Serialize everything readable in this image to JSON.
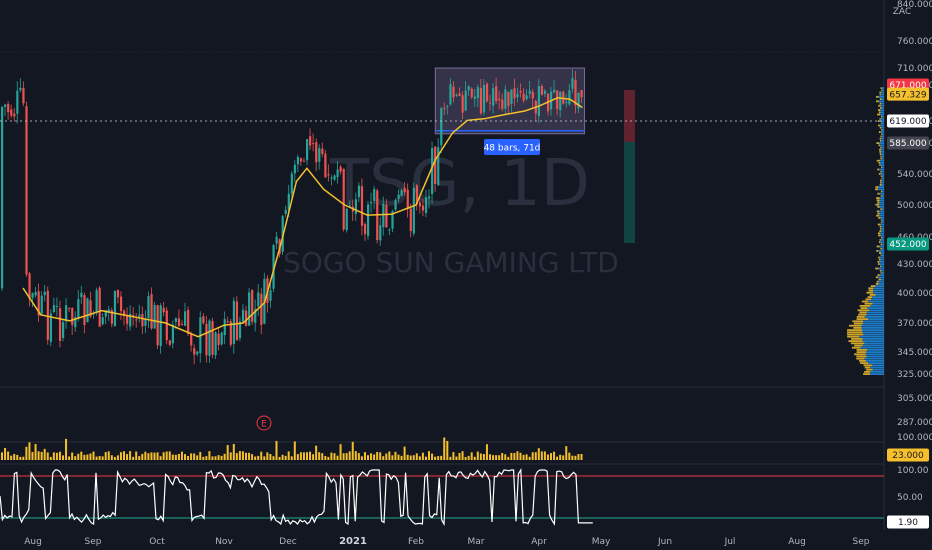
{
  "watermark": {
    "symbol": "TSG, 1D",
    "name": "SOGO SUN GAMING LTD"
  },
  "scale_label": "ZAC",
  "earnings_marker": "E",
  "range_annotation": "48 bars, 71d",
  "price_tags": [
    {
      "text": "671.000",
      "price": 671,
      "bg": "#f23645",
      "fg": "#ffffff"
    },
    {
      "text": "657.329",
      "price": 657.329,
      "bg": "#f5c02c",
      "fg": "#131722"
    },
    {
      "text": "619.000",
      "price": 619,
      "bg": "#ffffff",
      "fg": "#131722"
    },
    {
      "text": "585.000",
      "price": 585,
      "bg": "#434651",
      "fg": "#ffffff"
    },
    {
      "text": "452.000",
      "price": 452,
      "bg": "#089981",
      "fg": "#ffffff"
    }
  ],
  "volume_tag": {
    "text": "23.000",
    "value": 23,
    "bg": "#f5c02c",
    "fg": "#131722"
  },
  "oscillator_tag": {
    "text": "1.90",
    "value": 1.9,
    "bg": "#ffffff",
    "fg": "#131722"
  },
  "colors": {
    "background": "#131722",
    "up": "#26a69a",
    "down": "#ef5350",
    "ma": "#f5c02c",
    "volume": "#f5c02c",
    "oscillator": "#ffffff",
    "overbought_line": "#f23645",
    "oversold_line": "#22ab94",
    "box": "#b39ddb",
    "grid": "#1e222d"
  },
  "chart_data": [
    {
      "type": "candlestick",
      "title": "TSG, 1D",
      "subtitle": "SOGO SUN GAMING LTD",
      "x": {
        "tick_labels": [
          "Aug",
          "Sep",
          "Oct",
          "Nov",
          "Dec",
          "2021",
          "Feb",
          "Mar",
          "Apr",
          "May",
          "Jun",
          "Jul",
          "Aug",
          "Sep"
        ]
      },
      "y": {
        "scale": "log",
        "range": [
          300,
          850
        ],
        "tick_labels": [
          "840.000",
          "760.000",
          "710.000",
          "671.000",
          "619.000",
          "585.000",
          "540.000",
          "500.000",
          "460.000",
          "430.000",
          "400.000",
          "370.000",
          "345.000",
          "325.000",
          "305.000",
          "287.000"
        ]
      },
      "moving_average": {
        "points": [
          [
            "Jul 27",
            405
          ],
          [
            "Aug 5",
            378
          ],
          [
            "Aug 20",
            372
          ],
          [
            "Sep 5",
            382
          ],
          [
            "Sep 20",
            376
          ],
          [
            "Oct 5",
            370
          ],
          [
            "Oct 20",
            358
          ],
          [
            "Nov 1",
            368
          ],
          [
            "Nov 10",
            370
          ],
          [
            "Nov 20",
            390
          ],
          [
            "Nov 28",
            455
          ],
          [
            "Dec 5",
            530
          ],
          [
            "Dec 10",
            548
          ],
          [
            "Dec 18",
            520
          ],
          [
            "Dec 28",
            500
          ],
          [
            "Jan 8",
            487
          ],
          [
            "Jan 20",
            488
          ],
          [
            "Feb 1",
            500
          ],
          [
            "Feb 10",
            560
          ],
          [
            "Feb 18",
            600
          ],
          [
            "Feb 25",
            620
          ],
          [
            "Mar 5",
            622
          ],
          [
            "Mar 15",
            628
          ],
          [
            "Mar 25",
            633
          ],
          [
            "Apr 1",
            640
          ],
          [
            "Apr 10",
            652
          ],
          [
            "Apr 16",
            650
          ],
          [
            "Apr 22",
            638
          ]
        ]
      },
      "range_box": {
        "from": "Feb 10",
        "to": "Apr 23",
        "high": 710,
        "low": 599
      }
    },
    {
      "type": "bar",
      "title": "",
      "y": {
        "tick_labels": [
          "100.000"
        ],
        "last_value": 23
      }
    },
    {
      "type": "line",
      "title": "",
      "y": {
        "range": [
          0,
          100
        ],
        "tick_labels": [
          "100.00",
          "50.00"
        ],
        "levels": [
          80,
          20
        ],
        "last_value": 1.9
      }
    }
  ]
}
